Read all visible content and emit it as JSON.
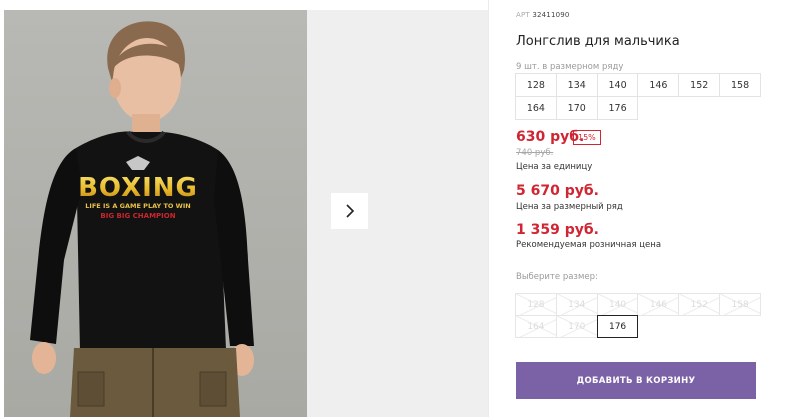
{
  "product": {
    "article_prefix": "АРТ",
    "article_number": "32411090",
    "title": "Лонгслив для мальчика",
    "image_alt": "Мальчик в черном лонгсливе с надписью BOXING"
  },
  "size_row": {
    "note": "9 шт. в размерном ряду",
    "sizes": [
      "128",
      "134",
      "140",
      "146",
      "152",
      "158",
      "164",
      "170",
      "176"
    ]
  },
  "pricing": {
    "unit_price": "630 руб.",
    "discount_badge": "15%",
    "old_price": "740 руб.",
    "unit_caption": "Цена за единицу",
    "row_price": "5 670 руб.",
    "row_caption": "Цена за размерный ряд",
    "rrp_price": "1 359 руб.",
    "rrp_caption": "Рекомендуемая розничная цена"
  },
  "size_picker": {
    "label": "Выберите размер:",
    "options": [
      {
        "label": "128",
        "available": false
      },
      {
        "label": "134",
        "available": false
      },
      {
        "label": "140",
        "available": false
      },
      {
        "label": "146",
        "available": false
      },
      {
        "label": "152",
        "available": false
      },
      {
        "label": "158",
        "available": false
      },
      {
        "label": "164",
        "available": false
      },
      {
        "label": "170",
        "available": false
      },
      {
        "label": "176",
        "available": true
      }
    ]
  },
  "actions": {
    "add_to_cart": "ДОБАВИТЬ В КОРЗИНУ"
  },
  "tshirt_print": {
    "headline": "BOXING",
    "tagline": "LIFE IS A GAME PLAY TO WIN",
    "subline": "BIG BIG CHAMPION"
  },
  "icons": {
    "next_arrow": "chevron-right-icon"
  },
  "colors": {
    "price_red": "#d02532",
    "cart_purple": "#7b61a5"
  }
}
